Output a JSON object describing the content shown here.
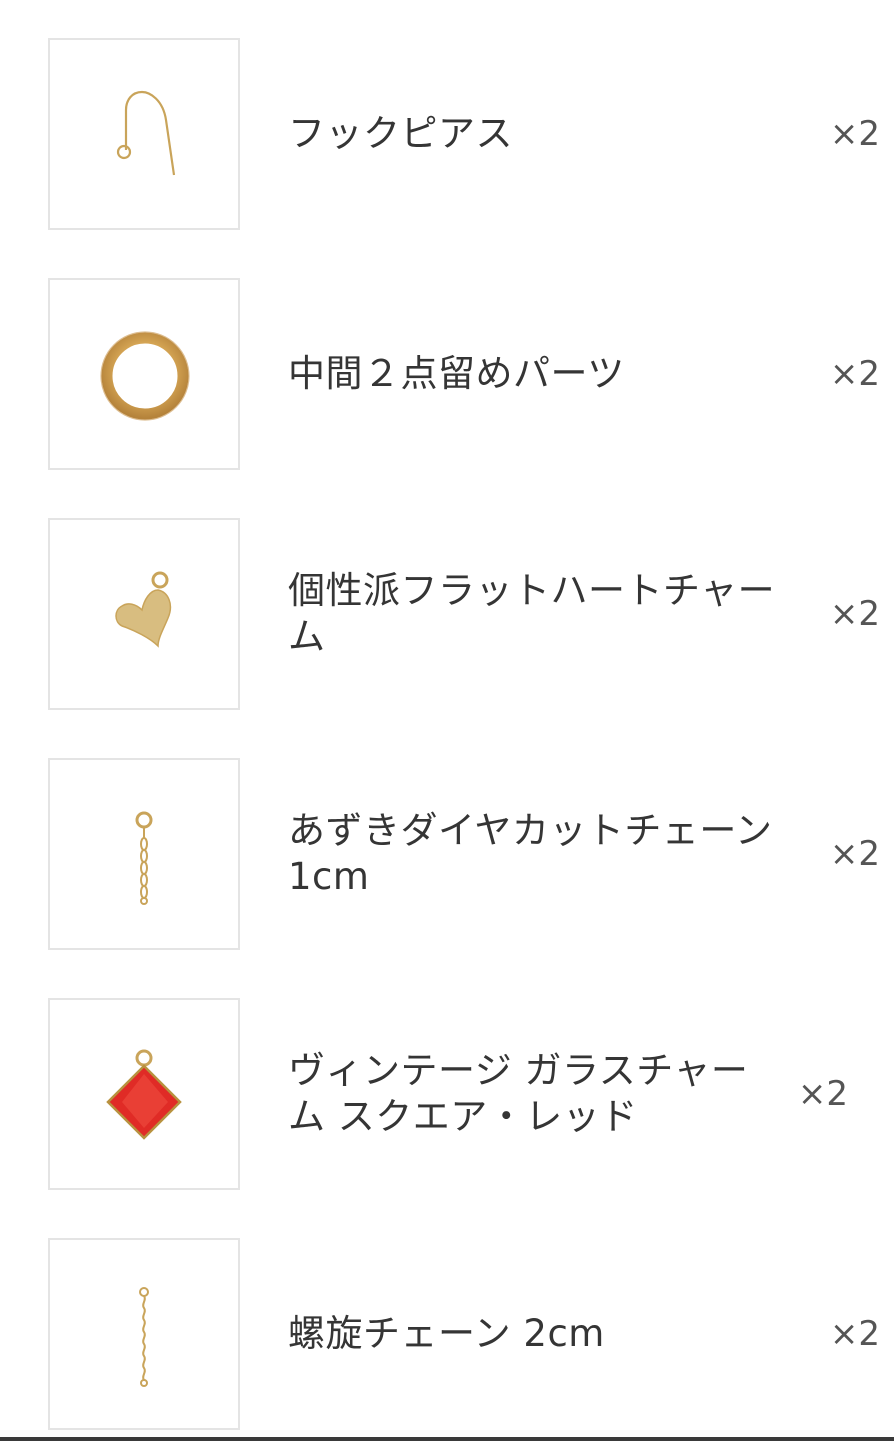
{
  "items": [
    {
      "name": "フックピアス",
      "qty": "×2",
      "icon": "hook-earring-icon"
    },
    {
      "name": "中間２点留めパーツ",
      "qty": "×2",
      "icon": "jump-ring-icon"
    },
    {
      "name": "個性派フラットハートチャーム",
      "qty": "×2",
      "icon": "heart-charm-icon"
    },
    {
      "name": "あずきダイヤカットチェーン1cm",
      "qty": "×2",
      "icon": "short-chain-icon"
    },
    {
      "name": "ヴィンテージ ガラスチャーム スクエア・レッド",
      "qty": "×2",
      "icon": "red-glass-charm-icon"
    },
    {
      "name": "螺旋チェーン 2cm",
      "qty": "×2",
      "icon": "spiral-chain-icon"
    }
  ],
  "colors": {
    "gold": "#c9a45a",
    "red": "#e02b26",
    "border": "#e4e4e4"
  }
}
